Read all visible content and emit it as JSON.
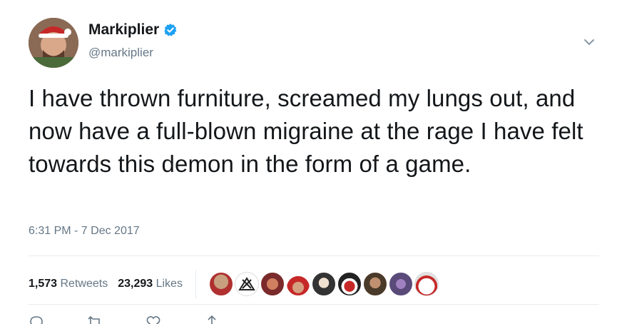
{
  "author": {
    "display_name": "Markiplier",
    "handle": "@markiplier",
    "verified": true
  },
  "tweet": {
    "text": "I have thrown furniture, screamed my lungs out, and now have a full-blown migraine at the rage I have felt towards this demon in the form of a game.",
    "timestamp": "6:31 PM - 7 Dec 2017"
  },
  "stats": {
    "retweets_count": "1,573",
    "retweets_label": "Retweets",
    "likes_count": "23,293",
    "likes_label": "Likes"
  },
  "colors": {
    "text_primary": "#14171a",
    "text_secondary": "#657786",
    "verified_blue": "#1da1f2",
    "divider": "#e6ecf0"
  },
  "icons": {
    "menu": "chevron-down-icon",
    "verified": "verified-badge-icon",
    "reply": "reply-icon",
    "retweet": "retweet-icon",
    "like": "heart-icon",
    "share": "share-icon"
  }
}
